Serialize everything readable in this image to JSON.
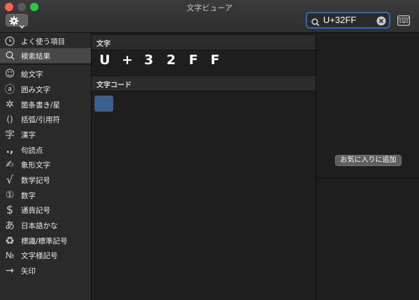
{
  "window": {
    "title": "文字ビューア"
  },
  "toolbar": {
    "gear_icon": "gear-icon",
    "search": {
      "value": "U+32FF"
    }
  },
  "sidebar": {
    "items": [
      {
        "icon": "🕘",
        "icon_name": "clock-icon",
        "label": "よく使う項目"
      },
      {
        "icon": "🔍",
        "icon_name": "search-icon",
        "label": "検索結果"
      },
      {
        "icon": "☺",
        "icon_name": "smiley-icon",
        "label": "絵文字"
      },
      {
        "icon": "ⓐ",
        "icon_name": "circled-a-icon",
        "label": "囲み文字"
      },
      {
        "icon": "✲",
        "icon_name": "asterisk-icon",
        "label": "箇条書き/星"
      },
      {
        "icon": "()",
        "icon_name": "parentheses-icon",
        "label": "括弧/引用符"
      },
      {
        "icon": "字",
        "icon_name": "kanji-icon",
        "label": "漢字"
      },
      {
        "icon": ".,",
        "icon_name": "punctuation-icon",
        "label": "句読点"
      },
      {
        "icon": "✍",
        "icon_name": "pictograph-icon",
        "label": "象形文字"
      },
      {
        "icon": "√",
        "icon_name": "square-root-icon",
        "label": "数学記号"
      },
      {
        "icon": "①",
        "icon_name": "circled-one-icon",
        "label": "数字"
      },
      {
        "icon": "$",
        "icon_name": "dollar-icon",
        "label": "通貨記号"
      },
      {
        "icon": "あ",
        "icon_name": "hiragana-icon",
        "label": "日本語かな"
      },
      {
        "icon": "♻",
        "icon_name": "recycle-icon",
        "label": "標識/標準記号"
      },
      {
        "icon": "№",
        "icon_name": "numero-icon",
        "label": "文字様記号"
      },
      {
        "icon": "→",
        "icon_name": "arrow-icon",
        "label": "矢印"
      }
    ]
  },
  "main": {
    "chars_header": "文字",
    "glyphs": [
      "U",
      "+",
      "3",
      "2",
      "F",
      "F"
    ],
    "code_header": "文字コード"
  },
  "detail": {
    "favorite_button": "お気に入りに追加"
  },
  "colors": {
    "accent": "#2f6bb3",
    "tile": "#3b5f8e"
  }
}
